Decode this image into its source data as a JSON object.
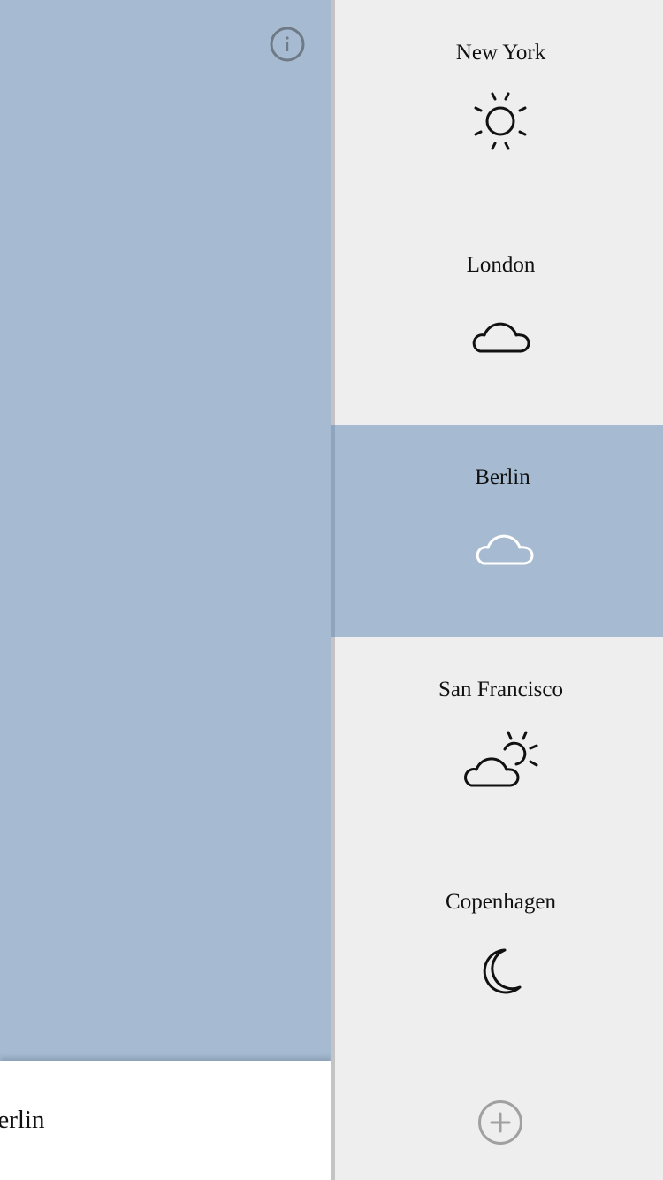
{
  "main": {
    "info_icon": "info-icon"
  },
  "bottom_bar": {
    "city_label": "Berlin"
  },
  "sidebar": {
    "cities": [
      {
        "name": "New York",
        "icon": "sun-icon",
        "selected": false
      },
      {
        "name": "London",
        "icon": "cloud-icon",
        "selected": false
      },
      {
        "name": "Berlin",
        "icon": "cloud-icon",
        "selected": true
      },
      {
        "name": "San Francisco",
        "icon": "partly-cloudy-icon",
        "selected": false
      },
      {
        "name": "Copenhagen",
        "icon": "moon-icon",
        "selected": false
      }
    ],
    "add_icon": "plus-icon"
  },
  "colors": {
    "accent": "#a6bbd1",
    "sidebar_bg": "#eeeeee",
    "bottom_bar_bg": "#ffffff",
    "icon_gray": "#6f7a86",
    "add_gray": "#a0a0a0"
  }
}
